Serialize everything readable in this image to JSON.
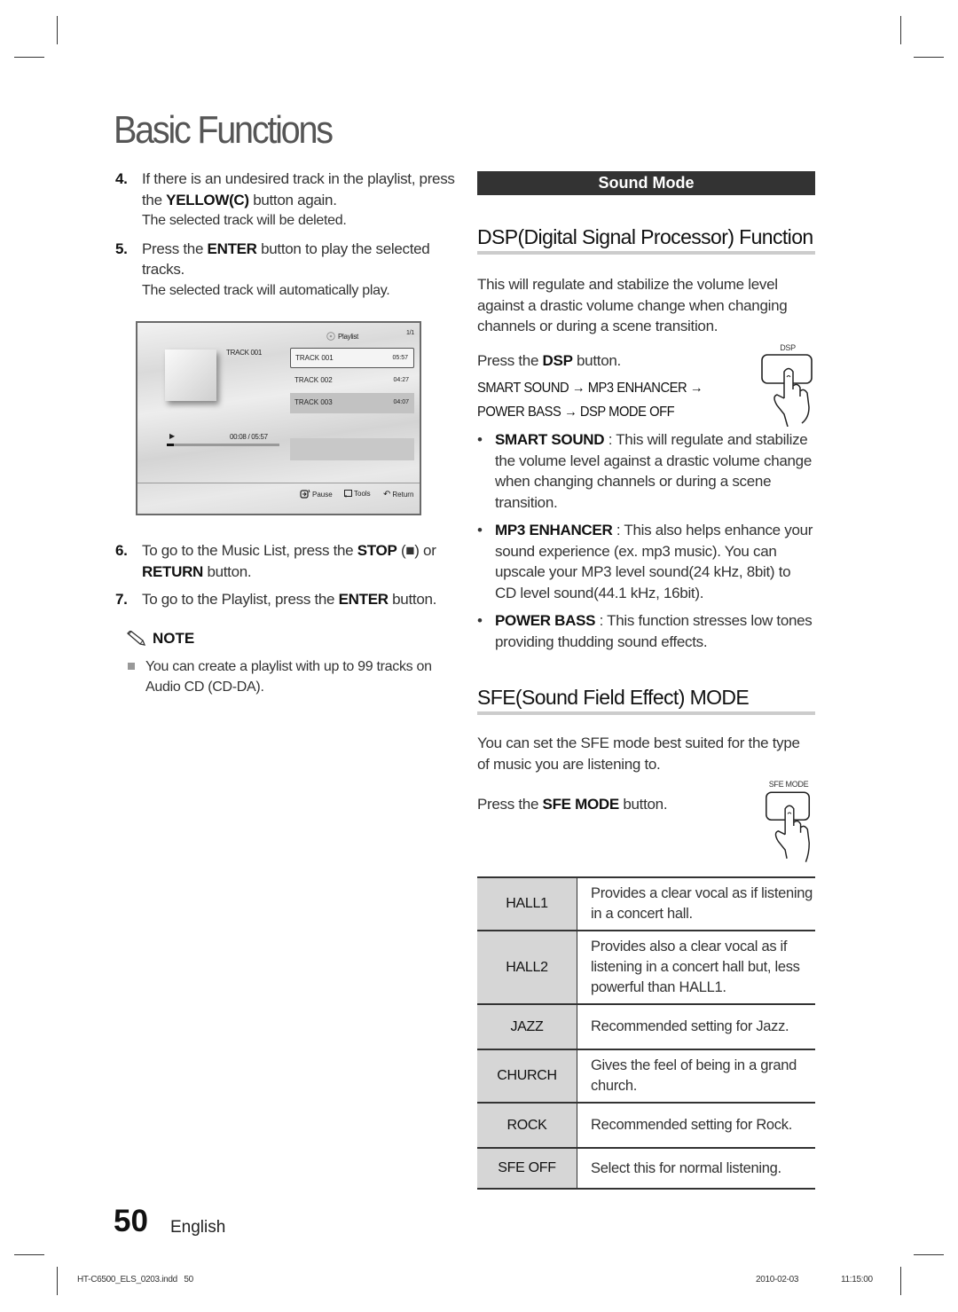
{
  "page": {
    "title": "Basic Functions",
    "page_number": "50",
    "language": "English",
    "slug_file": "HT-C6500_ELS_0203.indd   50",
    "slug_date": "2010-02-03",
    "slug_time": "11:15:00"
  },
  "left": {
    "steps": [
      {
        "num": "4.",
        "pre": "If there is an undesired track in the playlist, press the ",
        "bold": "YELLOW(C)",
        "post": " button again.",
        "sub": "The selected track will be deleted."
      },
      {
        "num": "5.",
        "pre": "Press the ",
        "bold": "ENTER",
        "post": " button to play the selected tracks.",
        "sub": "The selected track will automatically play."
      },
      {
        "num": "6.",
        "pre": "To go to the Music List, press the ",
        "bold": "STOP",
        "mid": " (■) or ",
        "bold2": "RETURN",
        "post": " button."
      },
      {
        "num": "7.",
        "pre": "To go to the Playlist, press the ",
        "bold": "ENTER",
        "post": " button."
      }
    ],
    "note_label": "NOTE",
    "note_text": "You can create a playlist with up to 99 tracks on Audio CD (CD-DA)."
  },
  "osd": {
    "header": "Playlist",
    "page_indicator": "1/1",
    "now_playing": "TRACK 001",
    "elapsed": "00:08 / 05:57",
    "progress_fraction": 0.022,
    "tracks": [
      {
        "name": "TRACK 001",
        "duration": "05:57"
      },
      {
        "name": "TRACK 002",
        "duration": "04:27"
      },
      {
        "name": "TRACK 003",
        "duration": "04:07"
      }
    ],
    "buttons": {
      "pause": "Pause",
      "tools": "Tools",
      "return": "Return"
    }
  },
  "right": {
    "section_bar": "Sound Mode",
    "dsp": {
      "heading": "DSP(Digital Signal Processor) Function",
      "intro": "This will regulate and stabilize the volume level against a drastic volume change when changing channels or during a scene transition.",
      "press_pre": "Press the ",
      "press_bold": "DSP",
      "press_post": " button.",
      "button_caption": "DSP",
      "sequence_line1": "SMART SOUND  →  MP3 ENHANCER →",
      "sequence_line2": "POWER BASS →  DSP MODE OFF",
      "bullets": [
        {
          "term": "SMART SOUND",
          "text": " : This will regulate and stabilize the volume level against a drastic volume change when changing channels or during a scene transition."
        },
        {
          "term": "MP3 ENHANCER",
          "text": " : This also helps enhance your sound experience (ex. mp3 music). You can upscale your MP3 level sound(24 kHz, 8bit) to CD level sound(44.1 kHz, 16bit)."
        },
        {
          "term": "POWER BASS",
          "text": " : This function stresses low tones providing thudding sound effects."
        }
      ]
    },
    "sfe": {
      "heading": "SFE(Sound Field Effect) MODE",
      "intro": "You can set the SFE mode best suited for the type of music you are listening to.",
      "press_pre": "Press the ",
      "press_bold": "SFE MODE",
      "press_post": " button.",
      "button_caption": "SFE MODE",
      "modes": [
        {
          "mode": "HALL1",
          "desc": "Provides a clear vocal as if listening in a concert hall."
        },
        {
          "mode": "HALL2",
          "desc": "Provides also a clear vocal as if listening in a concert hall but, less powerful than HALL1."
        },
        {
          "mode": "JAZZ",
          "desc": "Recommended setting for Jazz."
        },
        {
          "mode": "CHURCH",
          "desc": "Gives the feel of being in a grand church."
        },
        {
          "mode": "ROCK",
          "desc": "Recommended setting for Rock."
        },
        {
          "mode": "SFE OFF",
          "desc": "Select this for normal listening."
        }
      ]
    }
  }
}
